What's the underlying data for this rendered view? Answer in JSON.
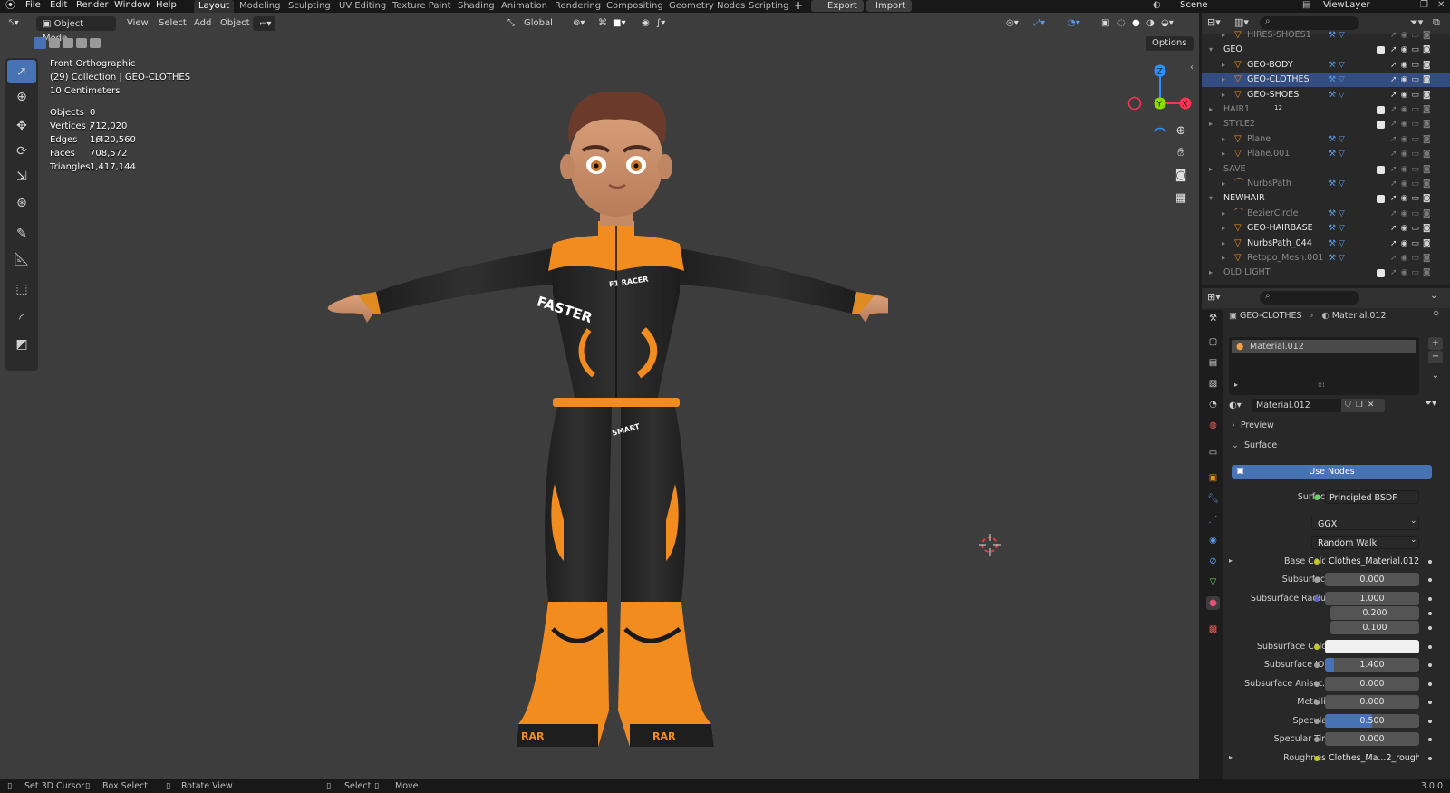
{
  "topbar": {
    "menus": [
      "File",
      "Edit",
      "Render",
      "Window",
      "Help"
    ],
    "workspaces": [
      "Layout",
      "Modeling",
      "Sculpting",
      "UV Editing",
      "Texture Paint",
      "Shading",
      "Animation",
      "Rendering",
      "Compositing",
      "Geometry Nodes",
      "Scripting"
    ],
    "export_label": "Export",
    "import_label": "Import",
    "scene": "Scene",
    "view_layer": "ViewLayer"
  },
  "viewport": {
    "mode": "Object Mode",
    "menus": [
      "View",
      "Select",
      "Add",
      "Object"
    ],
    "transform_orientation": "Global",
    "options_label": "Options",
    "view_name": "Front Orthographic",
    "collection_line": "(29) Collection | GEO-CLOTHES",
    "scale_line": "10 Centimeters",
    "stats": [
      {
        "label": "Objects",
        "value": "0 / 16"
      },
      {
        "label": "Vertices",
        "value": "712,020"
      },
      {
        "label": "Edges",
        "value": "1,420,560"
      },
      {
        "label": "Faces",
        "value": "708,572"
      },
      {
        "label": "Triangles",
        "value": "1,417,144"
      }
    ],
    "gizmo": {
      "x": "X",
      "y": "Y",
      "z": "Z"
    },
    "suit_text": {
      "chest": "FASTER",
      "badge": "F1 RACER",
      "hip": "SMART",
      "boot": "RAR"
    }
  },
  "outliner": {
    "rows": [
      {
        "name": "HIRES-SHOES1",
        "dim": true,
        "indent": 1,
        "type": "object"
      },
      {
        "name": "GEO",
        "dim": false,
        "indent": 0,
        "type": "collection"
      },
      {
        "name": "GEO-BODY",
        "dim": false,
        "indent": 1,
        "type": "object"
      },
      {
        "name": "GEO-CLOTHES",
        "dim": false,
        "indent": 1,
        "type": "object"
      },
      {
        "name": "GEO-SHOES",
        "dim": false,
        "indent": 1,
        "type": "object"
      },
      {
        "name": "HAIR1",
        "dim": true,
        "indent": 0,
        "type": "collection"
      },
      {
        "name": "STYLE2",
        "dim": true,
        "indent": 0,
        "type": "collection"
      },
      {
        "name": "Plane",
        "dim": true,
        "indent": 1,
        "type": "object"
      },
      {
        "name": "Plane.001",
        "dim": true,
        "indent": 1,
        "type": "object"
      },
      {
        "name": "SAVE",
        "dim": true,
        "indent": 0,
        "type": "collection"
      },
      {
        "name": "NurbsPath",
        "dim": true,
        "indent": 1,
        "type": "curve"
      },
      {
        "name": "NEWHAIR",
        "dim": false,
        "indent": 0,
        "type": "collection"
      },
      {
        "name": "BezierCircle",
        "dim": true,
        "indent": 1,
        "type": "curve"
      },
      {
        "name": "GEO-HAIRBASE",
        "dim": false,
        "indent": 1,
        "type": "object"
      },
      {
        "name": "NurbsPath_044",
        "dim": false,
        "indent": 1,
        "type": "object"
      },
      {
        "name": "Retopo_Mesh.001",
        "dim": true,
        "indent": 1,
        "type": "object"
      },
      {
        "name": "OLD LIGHT",
        "dim": true,
        "indent": 0,
        "type": "collection"
      }
    ],
    "hair_count": "12"
  },
  "properties": {
    "breadcrumb_object": "GEO-CLOTHES",
    "breadcrumb_material": "Material.012",
    "slot_name": "Material.012",
    "material_name": "Material.012",
    "preview_label": "Preview",
    "surface_panel": "Surface",
    "use_nodes_label": "Use Nodes",
    "surface_label": "Surface",
    "surface_value": "Principled BSDF",
    "distribution": "GGX",
    "subsurface_method": "Random Walk",
    "fields": [
      {
        "label": "Base Color",
        "value": "Clothes_Material.012_...",
        "kind": "texture"
      },
      {
        "label": "Subsurface",
        "value": "0.000",
        "kind": "number"
      },
      {
        "label": "Subsurface Radius",
        "value": "1.000",
        "kind": "number"
      },
      {
        "label": "",
        "value": "0.200",
        "kind": "number"
      },
      {
        "label": "",
        "value": "0.100",
        "kind": "number"
      },
      {
        "label": "Subsurface Color",
        "value": "",
        "kind": "color"
      },
      {
        "label": "Subsurface IOR",
        "value": "1.400",
        "kind": "number"
      },
      {
        "label": "Subsurface Anisot...",
        "value": "0.000",
        "kind": "number"
      },
      {
        "label": "Metallic",
        "value": "0.000",
        "kind": "number"
      },
      {
        "label": "Specular",
        "value": "0.500",
        "kind": "number"
      },
      {
        "label": "Specular Tint",
        "value": "0.000",
        "kind": "number"
      },
      {
        "label": "Roughness",
        "value": "Clothes_Ma...2_rough.jpg",
        "kind": "texture"
      }
    ],
    "subsurface_ior_fill": 0.1,
    "specular_fill": 0.5
  },
  "statusbar": {
    "items": [
      "Set 3D Cursor",
      "Box Select",
      "Rotate View",
      "Select",
      "Move"
    ],
    "version": "3.0.0"
  },
  "colors": {
    "accent": "#4772b3",
    "orange": "#f28c1f",
    "suit": "#262626"
  }
}
